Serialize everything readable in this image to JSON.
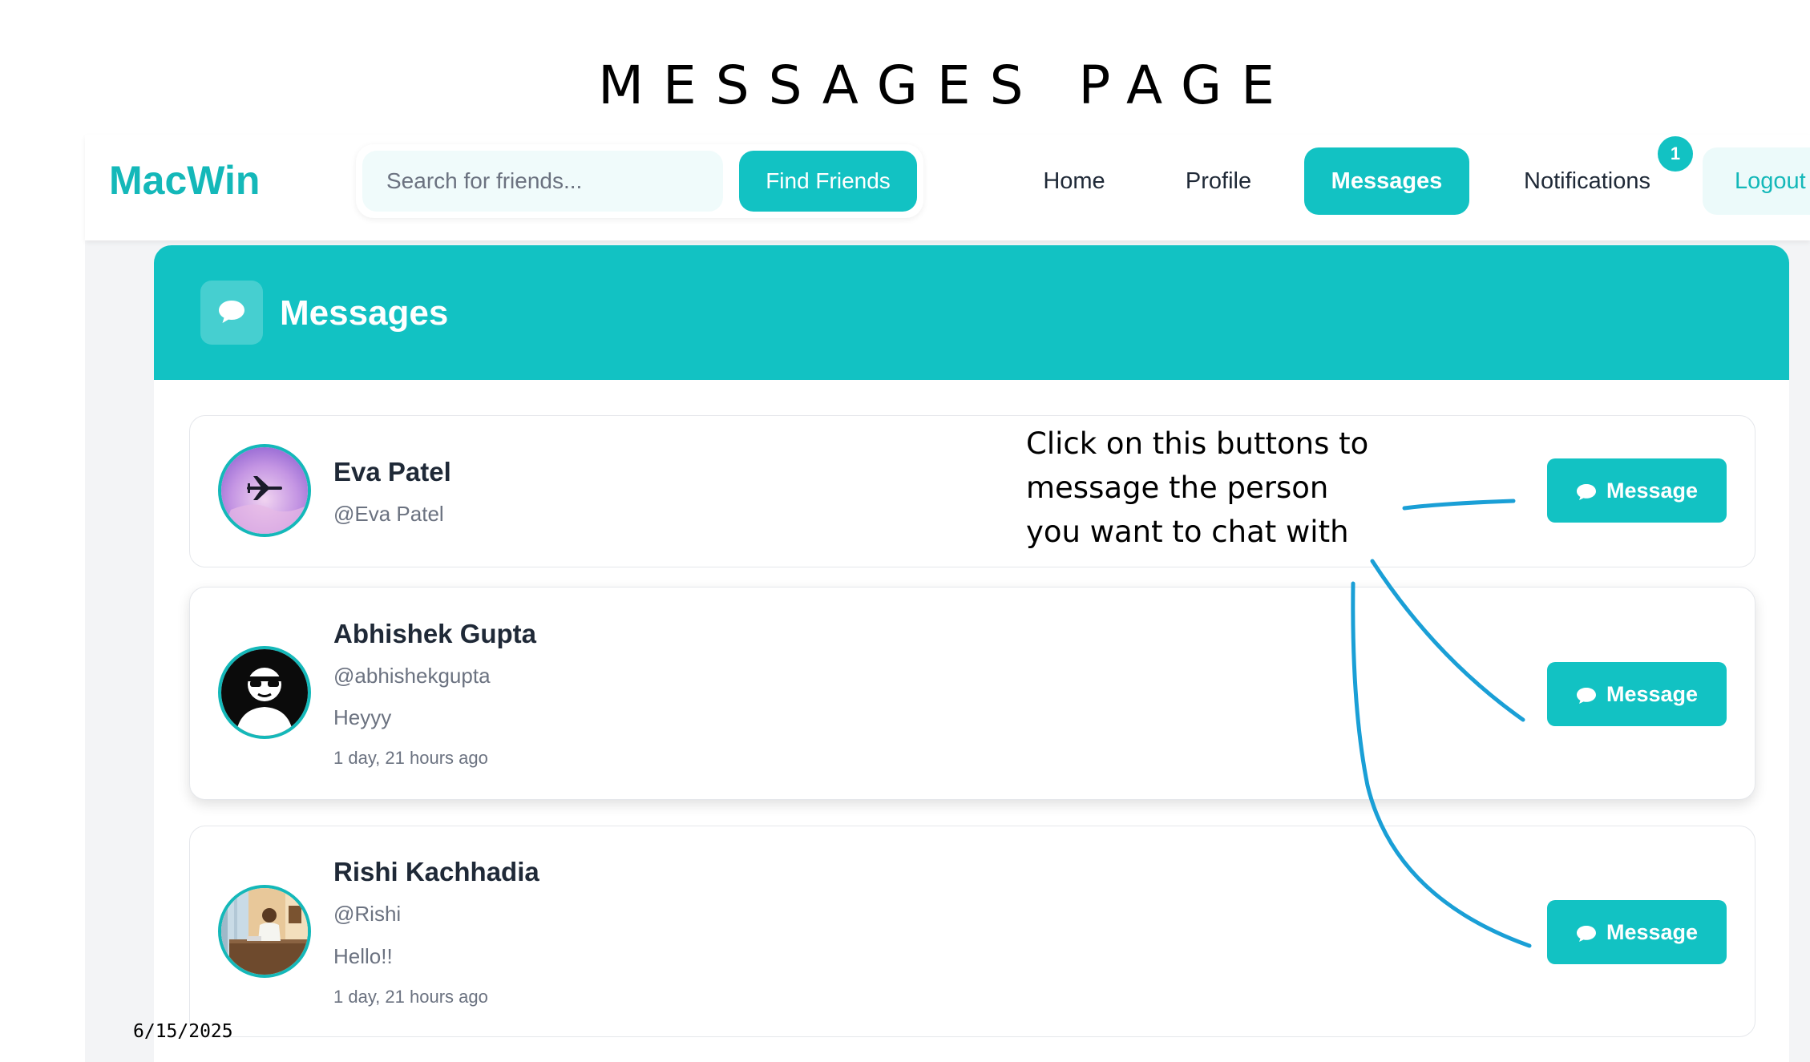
{
  "slide_title": "MESSAGES PAGE",
  "navbar": {
    "brand": "MacWin",
    "search_placeholder": "Search for friends...",
    "find_friends_label": "Find Friends",
    "links": {
      "home": "Home",
      "profile": "Profile",
      "messages": "Messages",
      "notifications": "Notifications",
      "logout": "Logout"
    },
    "notification_count": "1"
  },
  "panel": {
    "title": "Messages",
    "icon": "chat-bubble-icon"
  },
  "conversations": [
    {
      "name": "Eva Patel",
      "handle": "@Eva Patel",
      "preview": "",
      "time": "",
      "avatar": "airplane-sky-photo",
      "button_label": "Message"
    },
    {
      "name": "Abhishek Gupta",
      "handle": "@abhishekgupta",
      "preview": "Heyyy",
      "time": "1 day, 21 hours ago",
      "avatar": "sunglasses-figure-icon",
      "button_label": "Message"
    },
    {
      "name": "Rishi Kachhadia",
      "handle": "@Rishi",
      "preview": "Hello!!",
      "time": "1 day, 21 hours ago",
      "avatar": "person-at-table-photo",
      "button_label": "Message"
    }
  ],
  "annotation": {
    "lines": [
      "Click on this buttons to",
      "message the person",
      "you want to chat with"
    ],
    "arrow_color": "#1a9fd6"
  },
  "date_stamp": "6/15/2025",
  "colors": {
    "accent": "#12c2c3",
    "brand_text": "#14b8b9",
    "text_dark": "#1f2937",
    "text_muted": "#6b7280"
  }
}
